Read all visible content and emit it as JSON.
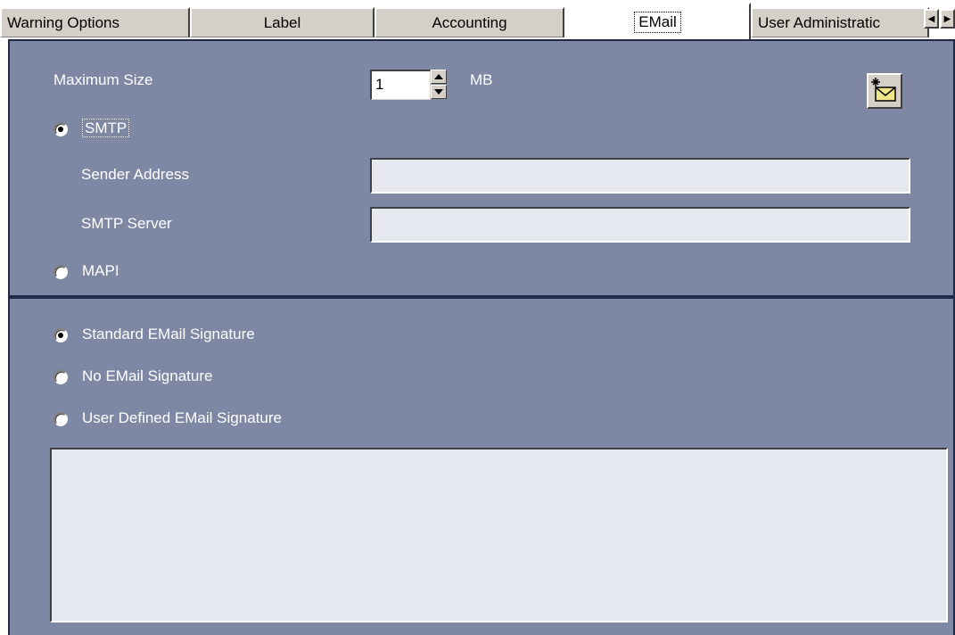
{
  "tabs": [
    {
      "label": "Warning Options",
      "active": false
    },
    {
      "label": "Label",
      "active": false
    },
    {
      "label": "Accounting",
      "active": false
    },
    {
      "label": "EMail",
      "active": true
    },
    {
      "label": "User Administratic",
      "active": false
    }
  ],
  "scroll_icons": {
    "left": "arrow-left-icon",
    "right": "arrow-right-icon"
  },
  "server_panel": {
    "max_size_label": "Maximum Size",
    "max_size_value": "1",
    "max_size_unit": "MB",
    "test_mail_icon": "mail-icon",
    "smtp_label": "SMTP",
    "smtp_selected": true,
    "sender_address_label": "Sender Address",
    "sender_address_value": "",
    "smtp_server_label": "SMTP Server",
    "smtp_server_value": "",
    "mapi_label": "MAPI",
    "mapi_selected": false
  },
  "signature_panel": {
    "options": [
      {
        "label": "Standard EMail Signature",
        "selected": true
      },
      {
        "label": "No EMail Signature",
        "selected": false
      },
      {
        "label": "User Defined EMail Signature",
        "selected": false
      }
    ],
    "signature_text": ""
  },
  "colors": {
    "panel_bg": "#7e87a3",
    "panel_border": "#1e2a4a",
    "field_bg": "#e5e8ee",
    "tab_bg": "#d4d0c8"
  }
}
